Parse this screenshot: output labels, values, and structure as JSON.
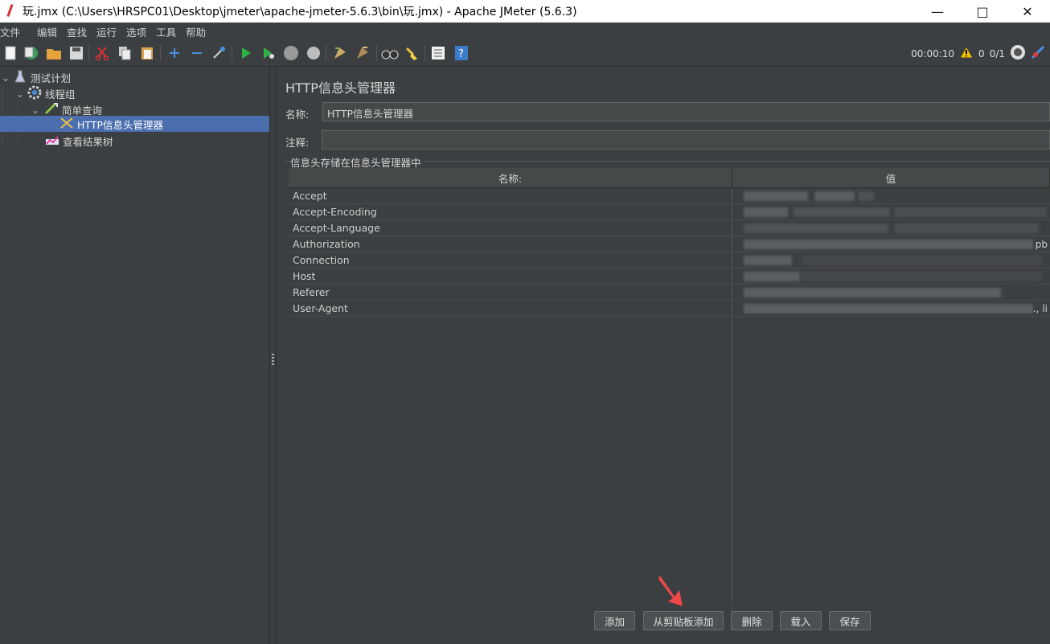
{
  "window": {
    "title": "玩.jmx (C:\\Users\\HRSPC01\\Desktop\\jmeter\\apache-jmeter-5.6.3\\bin\\玩.jmx) - Apache JMeter (5.6.3)"
  },
  "menu": [
    "文件",
    "编辑",
    "查找",
    "运行",
    "选项",
    "工具",
    "帮助"
  ],
  "toolbar_status": {
    "elapsed": "00:00:10",
    "warnings": "0",
    "threads": "0/1"
  },
  "tree": [
    {
      "label": "测试计划",
      "icon": "flask-icon"
    },
    {
      "label": "线程组",
      "icon": "gear-icon"
    },
    {
      "label": "简单查询",
      "icon": "pipette-icon"
    },
    {
      "label": "HTTP信息头管理器",
      "icon": "tools-icon"
    },
    {
      "label": "查看结果树",
      "icon": "chart-icon"
    }
  ],
  "panel": {
    "title": "HTTP信息头管理器",
    "name_label": "名称:",
    "name_value": "HTTP信息头管理器",
    "comment_label": "注释:",
    "comment_value": "",
    "group_title": "信息头存储在信息头管理器中"
  },
  "table": {
    "col_name": "名称:",
    "col_value": "值",
    "rows": [
      {
        "name": "Accept",
        "tail": ""
      },
      {
        "name": "Accept-Encoding",
        "tail": ""
      },
      {
        "name": "Accept-Language",
        "tail": ""
      },
      {
        "name": "Authorization",
        "tail": "pb"
      },
      {
        "name": "Connection",
        "tail": ""
      },
      {
        "name": "Host",
        "tail": ""
      },
      {
        "name": "Referer",
        "tail": ""
      },
      {
        "name": "User-Agent",
        "tail": "., li"
      }
    ]
  },
  "buttons": {
    "add": "添加",
    "add_from_clipboard": "从剪贴板添加",
    "delete": "删除",
    "load": "载入",
    "save": "保存"
  },
  "colors": {
    "background": "#3c3f41",
    "selection": "#4b6eaf",
    "annotation_arrow": "#f04040"
  }
}
